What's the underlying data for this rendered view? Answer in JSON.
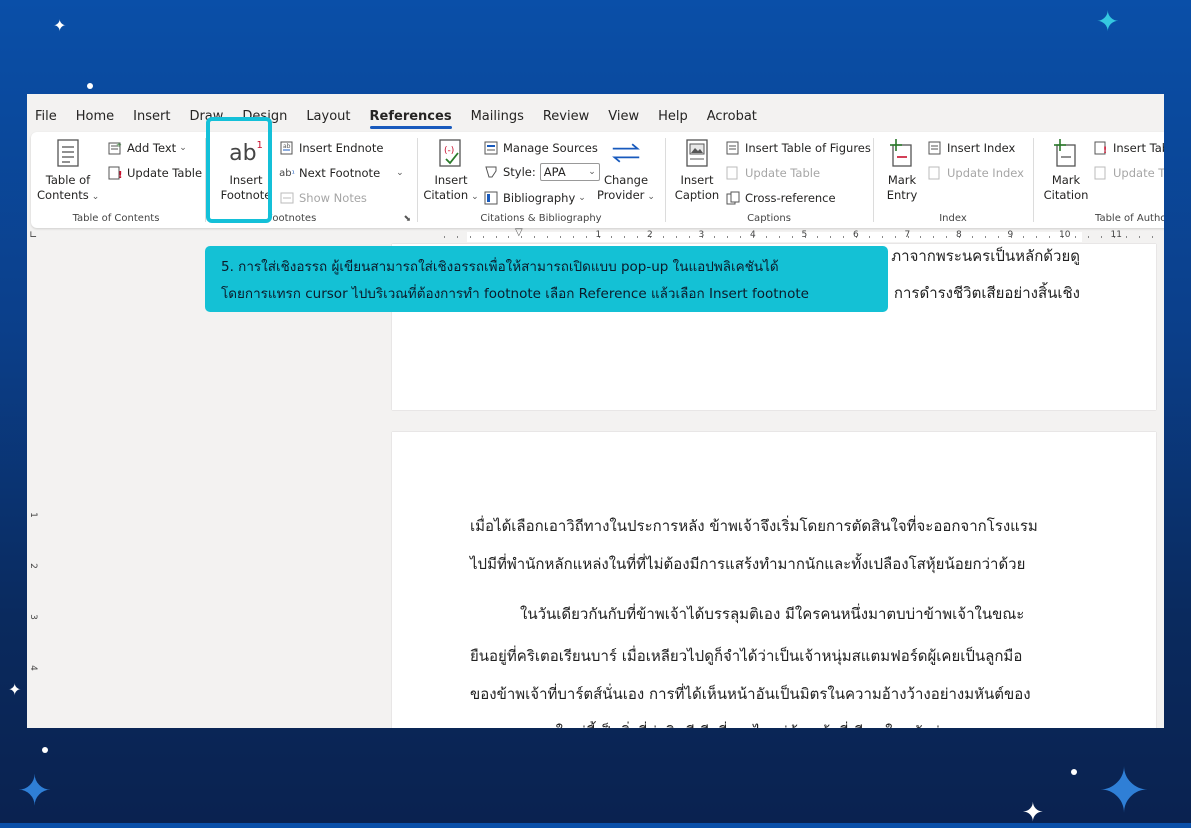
{
  "menu": {
    "tabs": [
      "File",
      "Home",
      "Insert",
      "Draw",
      "Design",
      "Layout",
      "References",
      "Mailings",
      "Review",
      "View",
      "Help",
      "Acrobat"
    ],
    "active": "References"
  },
  "ribbon": {
    "toc": {
      "toc_button": "Table of\nContents",
      "add_text": "Add Text",
      "update_table": "Update Table",
      "label": "Table of Contents"
    },
    "footnotes": {
      "insert_footnote": "Insert\nFootnote",
      "footnote_glyph": "ab",
      "footnote_sup": "1",
      "insert_endnote": "Insert Endnote",
      "next_footnote": "Next Footnote",
      "show_notes": "Show Notes",
      "label": "Footnotes"
    },
    "citations": {
      "insert_citation": "Insert\nCitation",
      "manage_sources": "Manage Sources",
      "style_label": "Style:",
      "style_value": "APA",
      "bibliography": "Bibliography",
      "change_provider": "Change\nProvider",
      "label": "Citations & Bibliography"
    },
    "captions": {
      "insert_caption": "Insert\nCaption",
      "insert_table_of_figures": "Insert Table of Figures",
      "update_table": "Update Table",
      "cross_reference": "Cross-reference",
      "label": "Captions"
    },
    "index": {
      "mark_entry": "Mark\nEntry",
      "insert_index": "Insert Index",
      "update_index": "Update Index",
      "label": "Index"
    },
    "authorities": {
      "mark_citation": "Mark\nCitation",
      "insert_table": "Insert Table",
      "update_table": "Update Ta",
      "label": "Table of Autho"
    }
  },
  "ruler": {
    "numbers": [
      "1",
      "2",
      "3",
      "4",
      "5",
      "6",
      "7",
      "8",
      "9",
      "10",
      "11"
    ],
    "vnumbers": [
      "1",
      "2",
      "3",
      "4"
    ]
  },
  "callout": {
    "line1": "5. การใส่เชิงอรรถ ผู้เขียนสามารถใส่เชิงอรรถเพื่อให้สามารถเปิดแบบ pop-up ในแอปพลิเคชันได้",
    "line2": "โดยการแทรก cursor ไปบริเวณที่ต้องการทำ footnote  เลือก Reference  แล้วเลือก Insert footnote"
  },
  "document": {
    "page1_lines": [
      "ภาจากพระนครเป็นหลักด้วยดู",
      "การดำรงชีวิตเสียอย่างสิ้นเชิง"
    ],
    "page2_lines": [
      "เมื่อได้เลือกเอาวิถีทางในประการหลัง ข้าพเจ้าจึงเริ่มโดยการตัดสินใจที่จะออกจากโรงแรม",
      "ไปมีที่พำนักหลักแหล่งในที่ที่ไม่ต้องมีการแสร้งทำมากนักและทั้งเปลืองโสหุ้ยน้อยกว่าด้วย",
      "ในวันเดียวกันกับที่ข้าพเจ้าได้บรรลุมติเอง มีใครคนหนึ่งมาตบบ่าข้าพเจ้าในขณะ",
      "ยืนอยู่ที่คริเตอเรียนบาร์ เมื่อเหลียวไปดูก็จำได้ว่าเป็นเจ้าหนุ่มสแตมฟอร์ดผู้เคยเป็นลูกมือ",
      "ของข้าพเจ้าที่บาร์ตส์นั่นเอง การที่ได้เห็นหน้าอันเป็นมิตรในความอ้างว้างอย่างมหันต์ของ",
      "ลอนดอนนครใหญ่นี้เป็นสิ่งที่น่ายินดีเสียนี่กระไรแก่ข้าพเจ้าที่เดียว ในสมัยก่อนๆ สแตม"
    ]
  },
  "colors": {
    "accent": "#14c0d8",
    "word_blue": "#185abd",
    "bg_top": "#0a4fa8",
    "bg_bottom": "#0a2250"
  }
}
